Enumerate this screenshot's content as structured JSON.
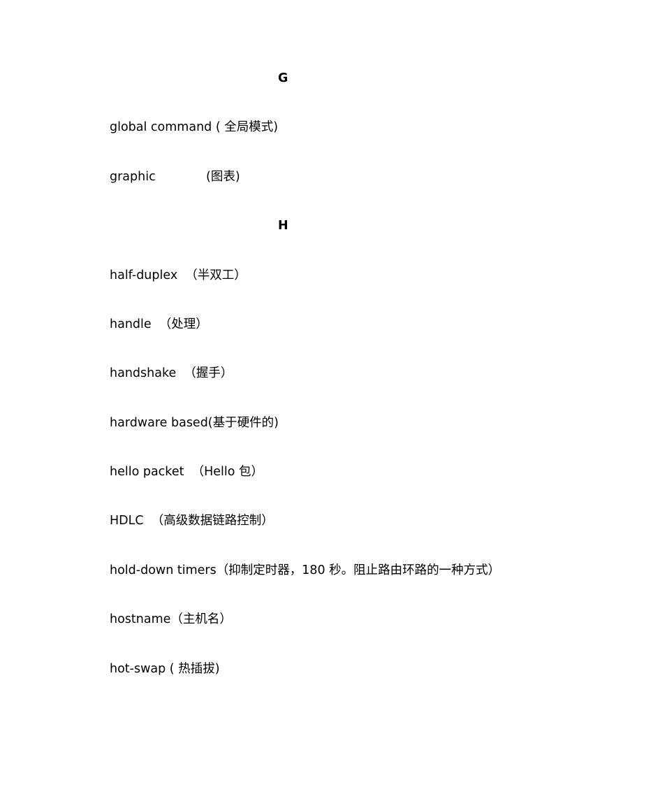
{
  "sections": [
    {
      "letter": "G",
      "entries": [
        "global command ( 全局模式)",
        "graphic             (图表)"
      ]
    },
    {
      "letter": "H",
      "entries": [
        "half-duplex  （半双工）",
        "handle  （处理）",
        "handshake  （握手）",
        "hardware based(基于硬件的)",
        "hello packet  （Hello 包）",
        "HDLC  （高级数据链路控制）",
        "hold-down timers（抑制定时器，180 秒。阻止路由环路的一种方式）",
        "hostname（主机名）",
        "hot-swap ( 热插拔)"
      ]
    }
  ]
}
